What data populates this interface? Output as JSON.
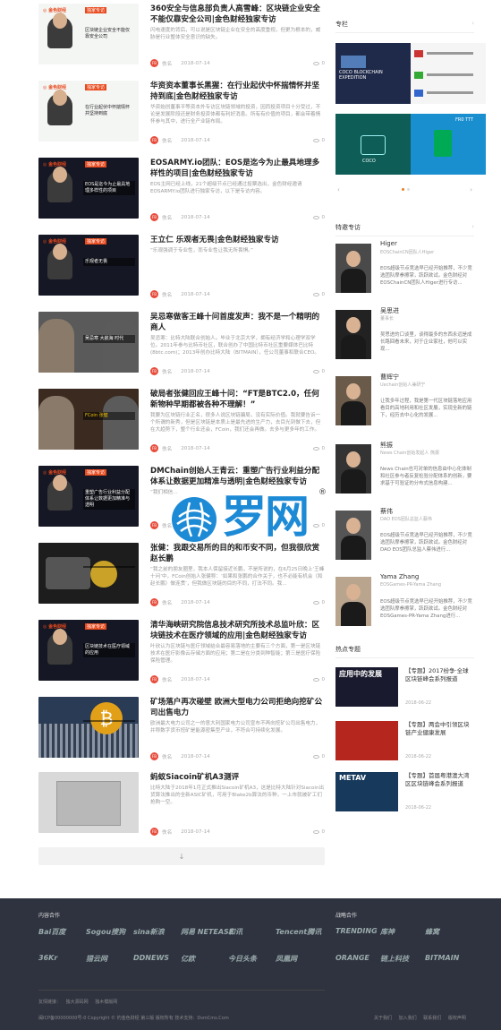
{
  "articles": [
    {
      "title": "360安全与信息部负责人高雪峰：区块链企业安全不能仅靠安全公司|金色财经独家专访",
      "desc": "闪电速度的背后，可以说是区块链企业在安全的高度重视，但更为根本的，威胁是行业整体安全意识的缺失。",
      "author": "佚名",
      "date": "2018-07-14",
      "views": "0",
      "thumb_text": "区块链企业安全不能仅靠安全公司",
      "theme": "light"
    },
    {
      "title": "华资资本董事长黑猩：在行业起伏中怀揣情怀并坚持到底|金色财经独家专访",
      "desc": "华资始创董事平等资本外专访区块链领域的投资，因而投资项目十分受过，不论是发展阶段还是财务投资体都有利好消息。所有有价值的项目，都会带着情怀参与其中，进行全产业链布局。",
      "author": "佚名",
      "date": "2018-07-14",
      "views": "0",
      "thumb_text": "在行业起伏中怀揣情怀并坚持到底",
      "theme": "light"
    },
    {
      "title": "EOSARMY.io团队：EOS是迄今为止最具地理多样性的项目|金色财经独家专访",
      "desc": "EOS主网已经上线，21个超级节点已经通过投票选出，金色财经邀请EOSARMY.io团队进行独家专访，以下是专访内容。",
      "author": "佚名",
      "date": "2018-07-14",
      "views": "0",
      "thumb_text": "EOS是迄今为止最具地理多样性的项目",
      "theme": "dark"
    },
    {
      "title": "王立仁 乐观者无畏|金色财经独家专访",
      "desc": "“乐观强调于专业性，而专业性让我无所畏惧。”",
      "author": "佚名",
      "date": "2018-07-14",
      "views": "0",
      "thumb_text": "乐观者无畏",
      "theme": "dark"
    },
    {
      "title": "吴忌寒做客王峰十问首度发声：我不是一个精明的商人",
      "desc": "吴忌寒：比特大陆联合创始人。毕业于北京大学，拥有经济学和心理学双学位。2011年参与比特币社区，联合创办了中国比特币社区重要媒体巴比特(8btc.com)；2013年创办比特大陆（BITMAIN），任公司董事和联合CEO。",
      "author": "佚名",
      "date": "2018-07-14",
      "views": "0",
      "thumb_text": "吴忌寒 大航海 时代",
      "theme": "photo"
    },
    {
      "title": "破局者张健回应王峰十问：“FT是BTC2.0，任何新物种早期都被各种不理解！”",
      "desc": "我要为区块链行业正名，很多人说区块链骗局，没有实际价值。我就要告诉一个所谓的新秀，但是区块链是本质上是最先进的生产力，去目光到做下去，但在大趋势下，整个行业还会，FCoin，我们还会再做。去多与更多年的工作。",
      "author": "佚名",
      "date": "2018-07-14",
      "views": "0",
      "thumb_text": "FCoin 张健",
      "theme": "photo2"
    },
    {
      "title": "DMChain创始人王青云：重塑广告行业利益分配体系让数据更加精准与透明|金色财经独家专访",
      "desc": "“我们相信...",
      "author": "佚名",
      "date": "2018-07-14",
      "views": "0",
      "thumb_text": "重塑广告行业利益分配体系让数据更加精准与透明",
      "theme": "dark"
    },
    {
      "title": "张健：我跟交易所的目的和币安不同，但我很欣赏赵长鹏",
      "desc": "“我之前的朋友圈里，我本人保留接近长鹏，不是所说的，在6月25日晚上‘王峰十问’中，FCoin创始人张健称：‘如果和张鹏的合作关于，也不必能有机会（和赵长鹏）做连贯’，但我做区块链的目的不同，打法不同。我...",
      "author": "佚名",
      "date": "2018-07-14",
      "views": "0",
      "thumb_text": "",
      "theme": "coin"
    },
    {
      "title": "清华海峡研究院信息技术研究所技术总监叶欣：区块链技术在医疗领域的应用|金色财经独家专访",
      "desc": "叶欣认为区块链与医疗领域结合最容易落地的主要有三个方面，第一是区块链技术在医疗影像云存储方面的应用；第二是在分类到种智能；第三是医疗保险保险管理。",
      "author": "佚名",
      "date": "2018-07-14",
      "views": "0",
      "thumb_text": "区块链技术在医疗领域的应用",
      "theme": "dark"
    },
    {
      "title": "矿场落户再次碰壁 欧洲大型电力公司拒绝向挖矿公司出售电力",
      "desc": "欧洲最大电力公司之一的意大利国家电力公司宣布不再向挖矿公司出售电力，并称数字货币挖矿是能源密集型产业，不符合可持续化发展。",
      "author": "佚名",
      "date": "2018-07-14",
      "views": "0",
      "thumb_text": "",
      "theme": "btc"
    },
    {
      "title": "蚂蚁Siacoin矿机A3测评",
      "desc": "比特大陆于2018年1月正式推出Siacoin矿机A3，这是比特大陆针对Siacoin出货算法推出的全新ASIC矿机，可用于Blake2b算法的币种，一上市就被矿工们抢购一空。",
      "author": "佚名",
      "date": "2018-07-14",
      "views": "0",
      "thumb_text": "",
      "theme": "miner"
    }
  ],
  "more_label": "↓",
  "sidebar": {
    "columns_title": "专栏",
    "columns_chevron": "›",
    "col_cards": [
      {
        "label": "COCO BLOCKCHAIN EXPEDITION"
      },
      {
        "label": ""
      },
      {
        "label": "COCO"
      },
      {
        "label": "FR0 TTT"
      }
    ],
    "experts_title": "特邀专访",
    "experts_chevron": "›",
    "experts": [
      {
        "name": "Higer",
        "role": "EOSChainCN团队人Higer",
        "desc": "EOS超级节点竞选早已经开始推荐，不少竞选团队摩拳擦掌，跃跃欲试。金色财经对EOSChainCN团队人Higer进行专访..."
      },
      {
        "name": "吴思进",
        "role": "董事长",
        "desc": "吴思进的口谈里，谈得最多的东西永远是成长路回看未来，对于企业家社，他可以实现..."
      },
      {
        "name": "曹辉宁",
        "role": "Uechain创始人兼研宁",
        "desc": "让我多年过程，我是第一代区块链落地应用看目的高地利用和社区发展，实现全新的链下，经历去中心化的发展..."
      },
      {
        "name": "熊振",
        "role": "News Chain创始发起人 熊振",
        "desc": "News Chain也可对单的信息由中心化体制和社区参与者反复检验分配体系的创新，要求基于可验证的分布式信息构建..."
      },
      {
        "name": "蔡伟",
        "role": "DAO EOS团队总监人蔡伟",
        "desc": "EOS超级节点竞选早已经开始推荐，不少竞选团队摩拳擦掌，跃跃欲试。金色财经对DAO EOS团队总监人蔡伟进行..."
      },
      {
        "name": "Yama Zhang",
        "role": "EOSGames-PR-Yama Zhang",
        "desc": "EOS超级节点竞选早已经开始推荐，不少竞选团队摩拳擦掌，跃跃欲试。金色财经对EOSGames-PR-Yama Zhang进行..."
      }
    ],
    "hot_title": "热点专题",
    "hot": [
      {
        "title": "【专题】2017纷争·全球区块链峰会系列报道",
        "date": "2018-06-22",
        "img_text": "应用中的发展"
      },
      {
        "title": "【专题】两会中引领区块链产业健康发展",
        "date": "2018-06-22",
        "img_text": ""
      },
      {
        "title": "【专题】首届粤港澳大湾区区块链峰会系列报道",
        "date": "2018-06-22",
        "img_text": "METAV"
      }
    ]
  },
  "watermark": {
    "text": "罗网",
    "reg": "®"
  },
  "footer": {
    "partners_title": "内容合作",
    "strategic_title": "战略合作",
    "partners": [
      "Bai百度",
      "Sogou搜狗",
      "sina新浪",
      "网易 NETEASE",
      "和讯",
      "Tencent腾讯",
      "36Kr",
      "猎云网",
      "DDNEWS",
      "亿欧",
      "今日头条",
      "凤凰网"
    ],
    "strategic": [
      "TRENDING",
      "库神",
      "蜂窝",
      "ORANGE",
      "链上科技",
      "BITMAIN"
    ],
    "links_label": "友情链接：",
    "links": [
      "独大源码网",
      "独木模版网"
    ],
    "copyright": "闽ICP备00000000号-0    Copyright © 钓金色财经 第三版 版权所有    技术支持：DsmCms.Com",
    "bottom_links": [
      "关于我们",
      "加入我们",
      "联系我们",
      "版权声明"
    ]
  }
}
